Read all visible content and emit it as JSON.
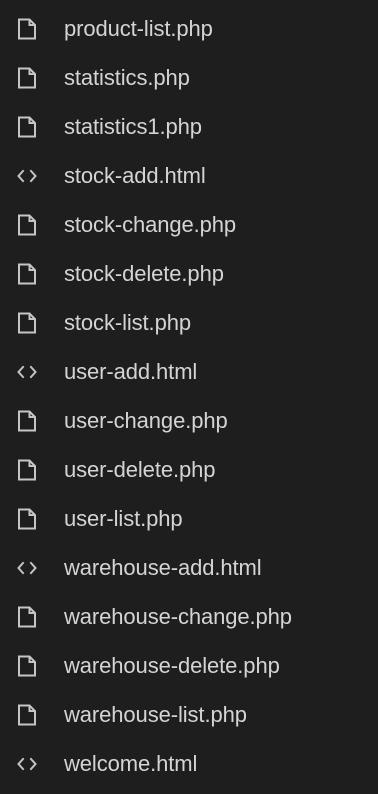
{
  "explorer": {
    "files": [
      {
        "name": "product-list.php",
        "icon": "file-icon"
      },
      {
        "name": "statistics.php",
        "icon": "file-icon"
      },
      {
        "name": "statistics1.php",
        "icon": "file-icon"
      },
      {
        "name": "stock-add.html",
        "icon": "code-icon"
      },
      {
        "name": "stock-change.php",
        "icon": "file-icon"
      },
      {
        "name": "stock-delete.php",
        "icon": "file-icon"
      },
      {
        "name": "stock-list.php",
        "icon": "file-icon"
      },
      {
        "name": "user-add.html",
        "icon": "code-icon"
      },
      {
        "name": "user-change.php",
        "icon": "file-icon"
      },
      {
        "name": "user-delete.php",
        "icon": "file-icon"
      },
      {
        "name": "user-list.php",
        "icon": "file-icon"
      },
      {
        "name": "warehouse-add.html",
        "icon": "code-icon"
      },
      {
        "name": "warehouse-change.php",
        "icon": "file-icon"
      },
      {
        "name": "warehouse-delete.php",
        "icon": "file-icon"
      },
      {
        "name": "warehouse-list.php",
        "icon": "file-icon"
      },
      {
        "name": "welcome.html",
        "icon": "code-icon"
      }
    ]
  },
  "colors": {
    "background": "#1e1e1e",
    "text": "#d4d4d4",
    "icon": "#c5c5c5"
  }
}
